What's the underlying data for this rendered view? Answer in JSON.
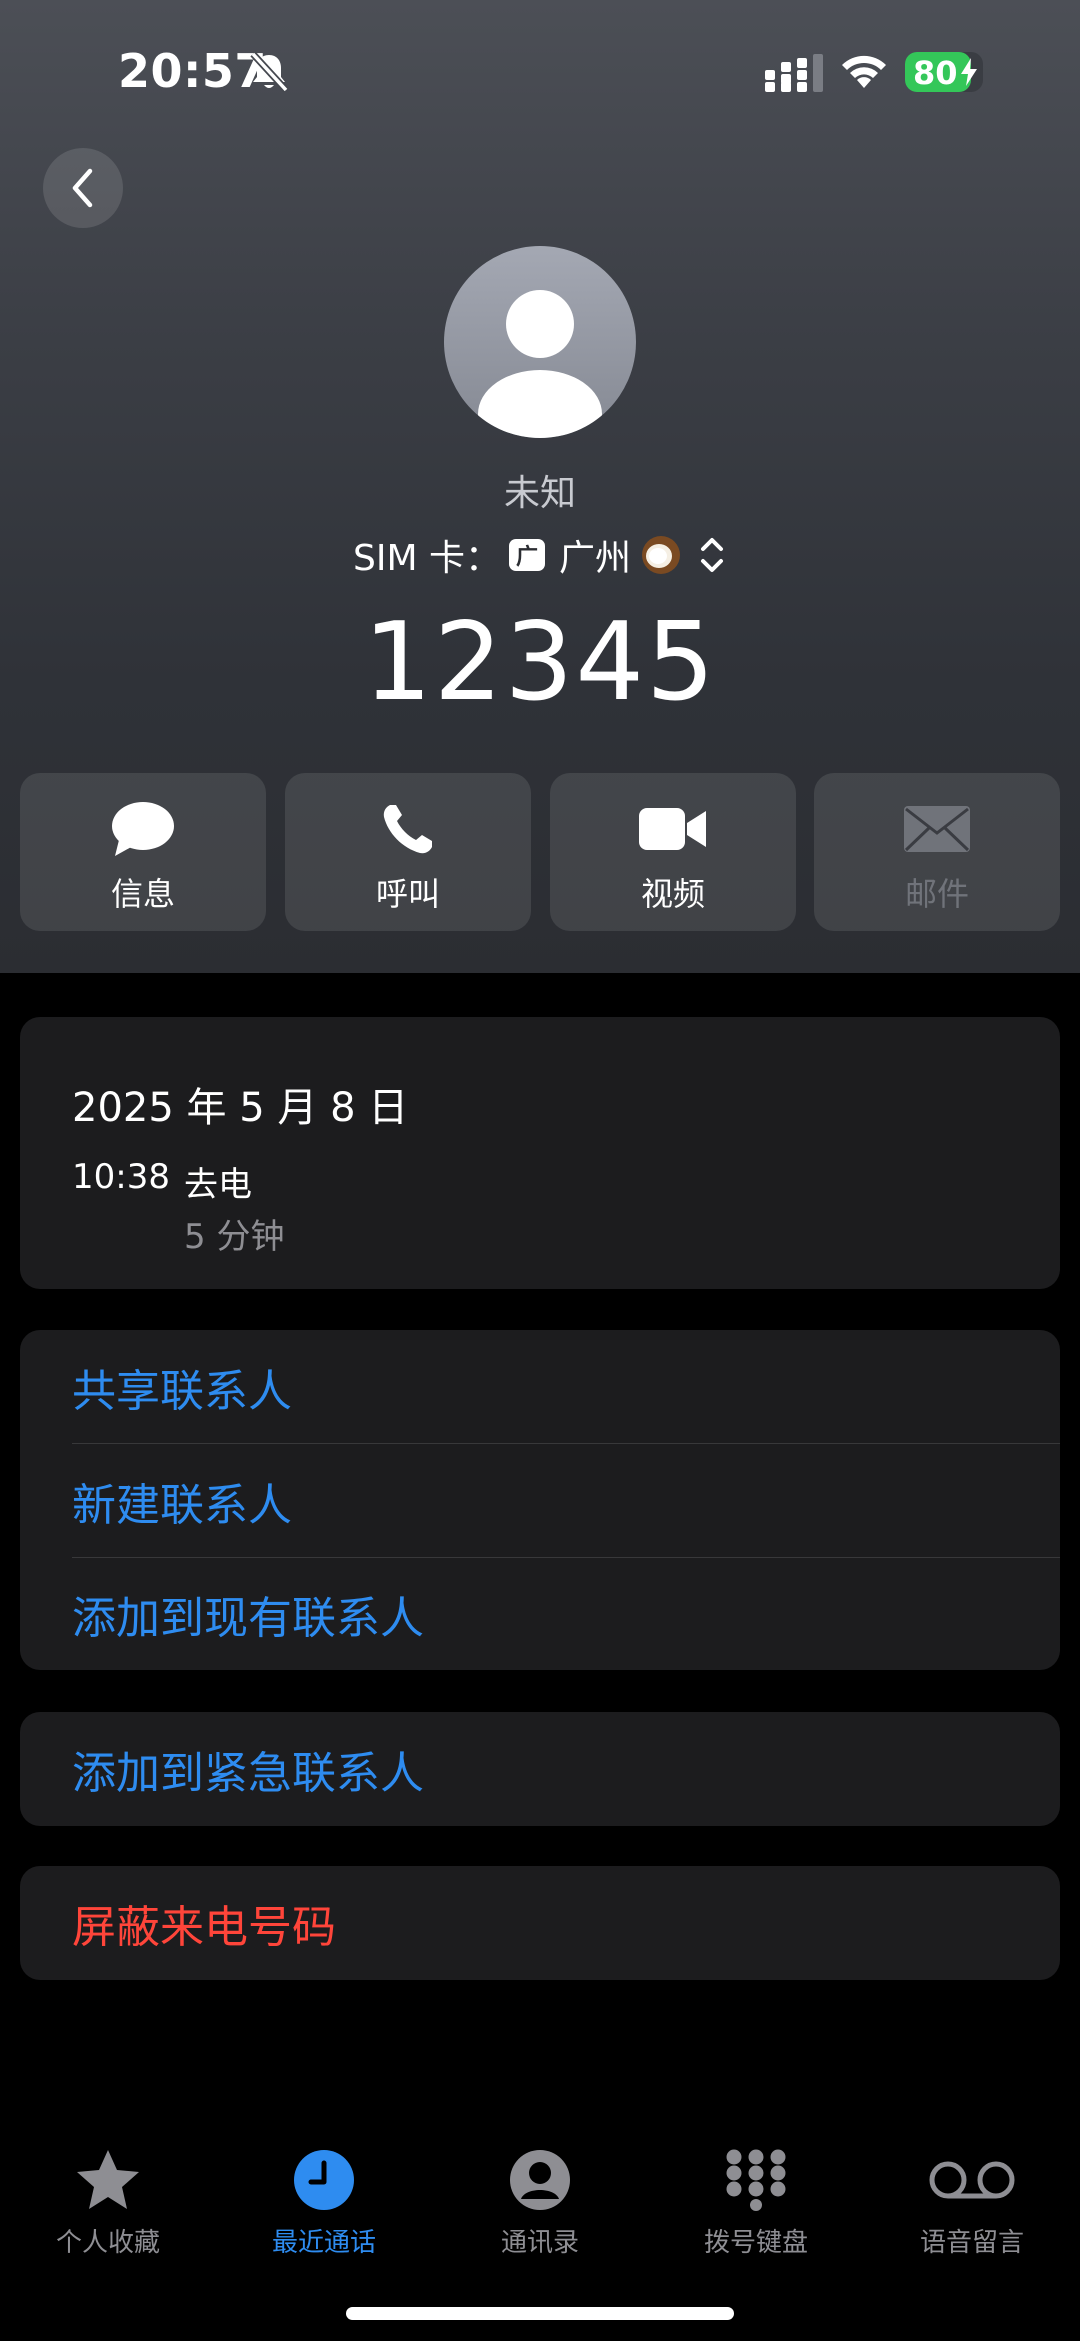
{
  "status_bar": {
    "time": "20:57",
    "battery_level": "80",
    "icons": [
      "bell-slash-icon",
      "cellular-signal-icon",
      "wifi-icon",
      "battery-charging-icon"
    ]
  },
  "header": {
    "back_icon": "chevron-left-icon",
    "contact_name": "未知",
    "sim_label": "SIM 卡：",
    "sim_badge": "广",
    "sim_name": "广州",
    "phone_number": "12345"
  },
  "actions": [
    {
      "label": "信息",
      "icon": "message-bubble-icon",
      "enabled": true
    },
    {
      "label": "呼叫",
      "icon": "phone-icon",
      "enabled": true
    },
    {
      "label": "视频",
      "icon": "video-camera-icon",
      "enabled": true
    },
    {
      "label": "邮件",
      "icon": "envelope-icon",
      "enabled": false
    }
  ],
  "call_log": {
    "date": "2025 年 5 月 8 日",
    "time": "10:38",
    "type": "去电",
    "duration": "5 分钟"
  },
  "contact_options": [
    "共享联系人",
    "新建联系人",
    "添加到现有联系人"
  ],
  "emergency_option": "添加到紧急联系人",
  "block_option": "屏蔽来电号码",
  "tabs": [
    {
      "label": "个人收藏",
      "icon": "star-icon",
      "active": false
    },
    {
      "label": "最近通话",
      "icon": "clock-icon",
      "active": true
    },
    {
      "label": "通讯录",
      "icon": "person-circle-icon",
      "active": false
    },
    {
      "label": "拨号键盘",
      "icon": "keypad-icon",
      "active": false
    },
    {
      "label": "语音留言",
      "icon": "voicemail-icon",
      "active": false
    }
  ],
  "colors": {
    "accent": "#2e8cf0",
    "destructive": "#ff453a",
    "battery": "#34c759",
    "card": "#1c1c1e"
  }
}
